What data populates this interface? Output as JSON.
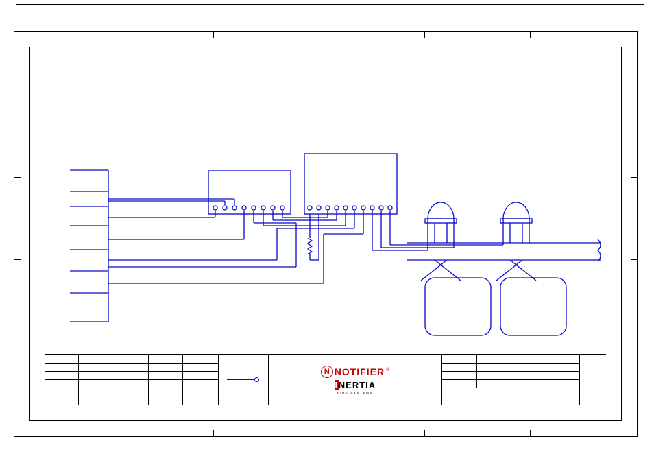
{
  "chart_data": {
    "type": "wiring-diagram",
    "left_block_rows": 7,
    "modules": [
      {
        "name": "module-small",
        "terminals": 8
      },
      {
        "name": "module-large",
        "terminals": 10
      }
    ],
    "beacons": 2,
    "rounded_boxes": 2
  },
  "logos": {
    "notifier_mark": "N",
    "notifier_word": "NOTIFIER",
    "notifier_reg": "®",
    "inertia_word": "INERTIA",
    "inertia_sub": "FIRE SYSTEMS"
  },
  "titleblock": {
    "left_cols": 5,
    "left_rows": 5,
    "right_cols": "2",
    "right_rows": 4,
    "legend_label": ""
  }
}
